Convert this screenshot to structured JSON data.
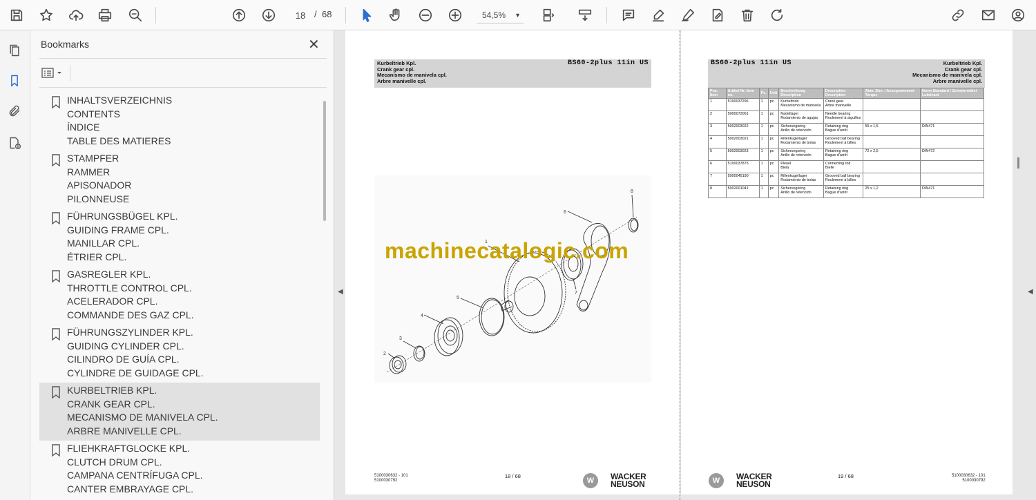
{
  "toolbar": {
    "current_page": "18",
    "page_separator": "/",
    "total_pages": "68",
    "zoom": "54,5%"
  },
  "panel": {
    "title": "Bookmarks",
    "bookmarks": [
      {
        "lines": [
          "INHALTSVERZEICHNIS",
          "CONTENTS",
          "ÍNDICE",
          "TABLE DES MATIERES"
        ],
        "selected": false
      },
      {
        "lines": [
          "STAMPFER",
          "RAMMER",
          "APISONADOR",
          "PILONNEUSE"
        ],
        "selected": false
      },
      {
        "lines": [
          "FÜHRUNGSBÜGEL KPL.",
          "GUIDING FRAME CPL.",
          "MANILLAR CPL.",
          "ÉTRIER CPL."
        ],
        "selected": false
      },
      {
        "lines": [
          "GASREGLER KPL.",
          "THROTTLE CONTROL CPL.",
          "ACELERADOR CPL.",
          "COMMANDE DES GAZ CPL."
        ],
        "selected": false
      },
      {
        "lines": [
          "FÜHRUNGSZYLINDER KPL.",
          "GUIDING CYLINDER CPL.",
          "CILINDRO DE GUÍA CPL.",
          "CYLINDRE DE GUIDAGE CPL."
        ],
        "selected": false
      },
      {
        "lines": [
          "KURBELTRIEB KPL.",
          "CRANK GEAR CPL.",
          "MECANISMO DE MANIVELA CPL.",
          "ARBRE MANIVELLE CPL."
        ],
        "selected": true
      },
      {
        "lines": [
          "FLIEHKRAFTGLOCKE KPL.",
          "CLUTCH DRUM CPL.",
          "CAMPANA CENTRÍFUGA CPL.",
          "CANTER EMBRAYAGE CPL."
        ],
        "selected": false
      }
    ]
  },
  "page18": {
    "title_lines": [
      "Kurbeltrieb Kpl.",
      "Crank gear cpl.",
      "Mecanismo de manivela cpl.",
      "Arbre manivelle cpl."
    ],
    "model": "BS60-2plus 11in US",
    "callouts": [
      "1",
      "2",
      "3",
      "4",
      "5",
      "6",
      "7",
      "8"
    ],
    "footer_code1": "5100030632 - 101",
    "footer_code2": "5100030792",
    "page_number": "18 / 68",
    "brand_line1": "WACKER",
    "brand_line2": "NEUSON"
  },
  "page19": {
    "title_lines": [
      "Kurbeltrieb Kpl.",
      "Crank gear cpl.",
      "Mecanismo de manivela cpl.",
      "Arbre manivelle cpl."
    ],
    "model": "BS60-2plus 11in US",
    "columns": [
      "Pos. Item",
      "Artikel Nr. Item no.",
      "Pc.",
      "Unit",
      "Beschreibung Description",
      "Description Description",
      "Abm. Dim. / Anzugsmoment Torque",
      "Norm Standard / Schmiermittel Lubricant"
    ],
    "rows": [
      {
        "pos": "1",
        "part": "5100037296",
        "qty": "1",
        "unit": "pc",
        "desc1": "Kurbeltrieb\nMecanismo de manivela",
        "desc2": "Crank gear\nArbre manivelle",
        "dim": "",
        "norm": ""
      },
      {
        "pos": "2",
        "part": "5000072061",
        "qty": "1",
        "unit": "pc",
        "desc1": "Nadellager\nRodamiento de agujas",
        "desc2": "Needle bearing\nRoulement à aiguilles",
        "dim": "",
        "norm": ""
      },
      {
        "pos": "3",
        "part": "5002003022",
        "qty": "1",
        "unit": "pc",
        "desc1": "Sicherungsring\nAnillo de retención",
        "desc2": "Retaining ring\nBague d'arrêt",
        "dim": "55 x 1,5",
        "norm": "DIN471"
      },
      {
        "pos": "4",
        "part": "5002003021",
        "qty": "1",
        "unit": "pc",
        "desc1": "Rillenkugellager\nRodamiento de bolas",
        "desc2": "Grooved ball bearing\nRoulement à billes",
        "dim": "",
        "norm": ""
      },
      {
        "pos": "5",
        "part": "5002003023",
        "qty": "1",
        "unit": "pc",
        "desc1": "Sicherungsring\nAnillo de retención",
        "desc2": "Retaining ring\nBague d'arrêt",
        "dim": "72 x 2,5",
        "norm": "DIN472"
      },
      {
        "pos": "6",
        "part": "5100037875",
        "qty": "1",
        "unit": "pc",
        "desc1": "Pleuel\nBiela",
        "desc2": "Connecting rod\nBielle",
        "dim": "",
        "norm": ""
      },
      {
        "pos": "7",
        "part": "5000045190",
        "qty": "1",
        "unit": "pc",
        "desc1": "Rillenkugellager\nRodamiento de bolas",
        "desc2": "Grooved ball bearing\nRoulement à billes",
        "dim": "",
        "norm": ""
      },
      {
        "pos": "8",
        "part": "5002001041",
        "qty": "1",
        "unit": "pc",
        "desc1": "Sicherungsring\nAnillo de retención",
        "desc2": "Retaining ring\nBague d'arrêt",
        "dim": "25 x 1,2",
        "norm": "DIN471"
      }
    ],
    "footer_code1": "5100030632 - 101",
    "footer_code2": "5100030792",
    "page_number": "19 / 68",
    "brand_line1": "WACKER",
    "brand_line2": "NEUSON"
  },
  "watermark": "machinecatalogic.com"
}
